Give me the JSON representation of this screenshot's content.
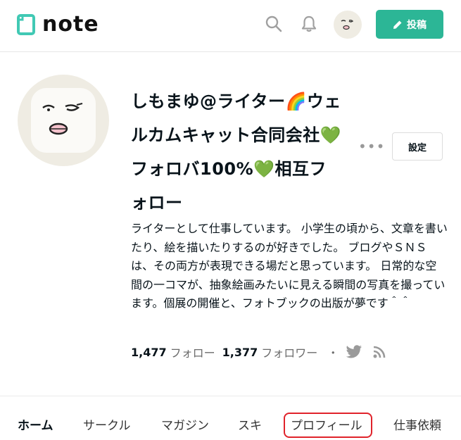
{
  "header": {
    "logo_text": "note",
    "post_label": "投稿",
    "brand_color": "#2cb696"
  },
  "profile": {
    "name": "しもまゆ@ライター🌈ウェルカムキャット合同会社💚フォロバ100%💚相互フォロー",
    "settings_label": "設定",
    "more_label": "•••",
    "bio": "ライターとして仕事しています。 小学生の頃から、文章を書いたり、絵を描いたりするのが好きでした。 ブログやＳＮＳは、その両方が表現できる場だと思っています。 日常的な空間の一コマが、抽象絵画みたいに見える瞬間の写真を撮っています。個展の開催と、フォトブックの出版が夢です＾＾",
    "follow_count": "1,477",
    "follow_label": "フォロー",
    "follower_count": "1,377",
    "follower_label": "フォロワー",
    "separator": "・"
  },
  "tabs": [
    {
      "label": "ホーム",
      "active": true
    },
    {
      "label": "サークル",
      "active": false
    },
    {
      "label": "マガジン",
      "active": false
    },
    {
      "label": "スキ",
      "active": false
    },
    {
      "label": "プロフィール",
      "active": false,
      "highlighted": true
    },
    {
      "label": "仕事依頼",
      "active": false
    }
  ],
  "highlight_color": "#e0232b"
}
